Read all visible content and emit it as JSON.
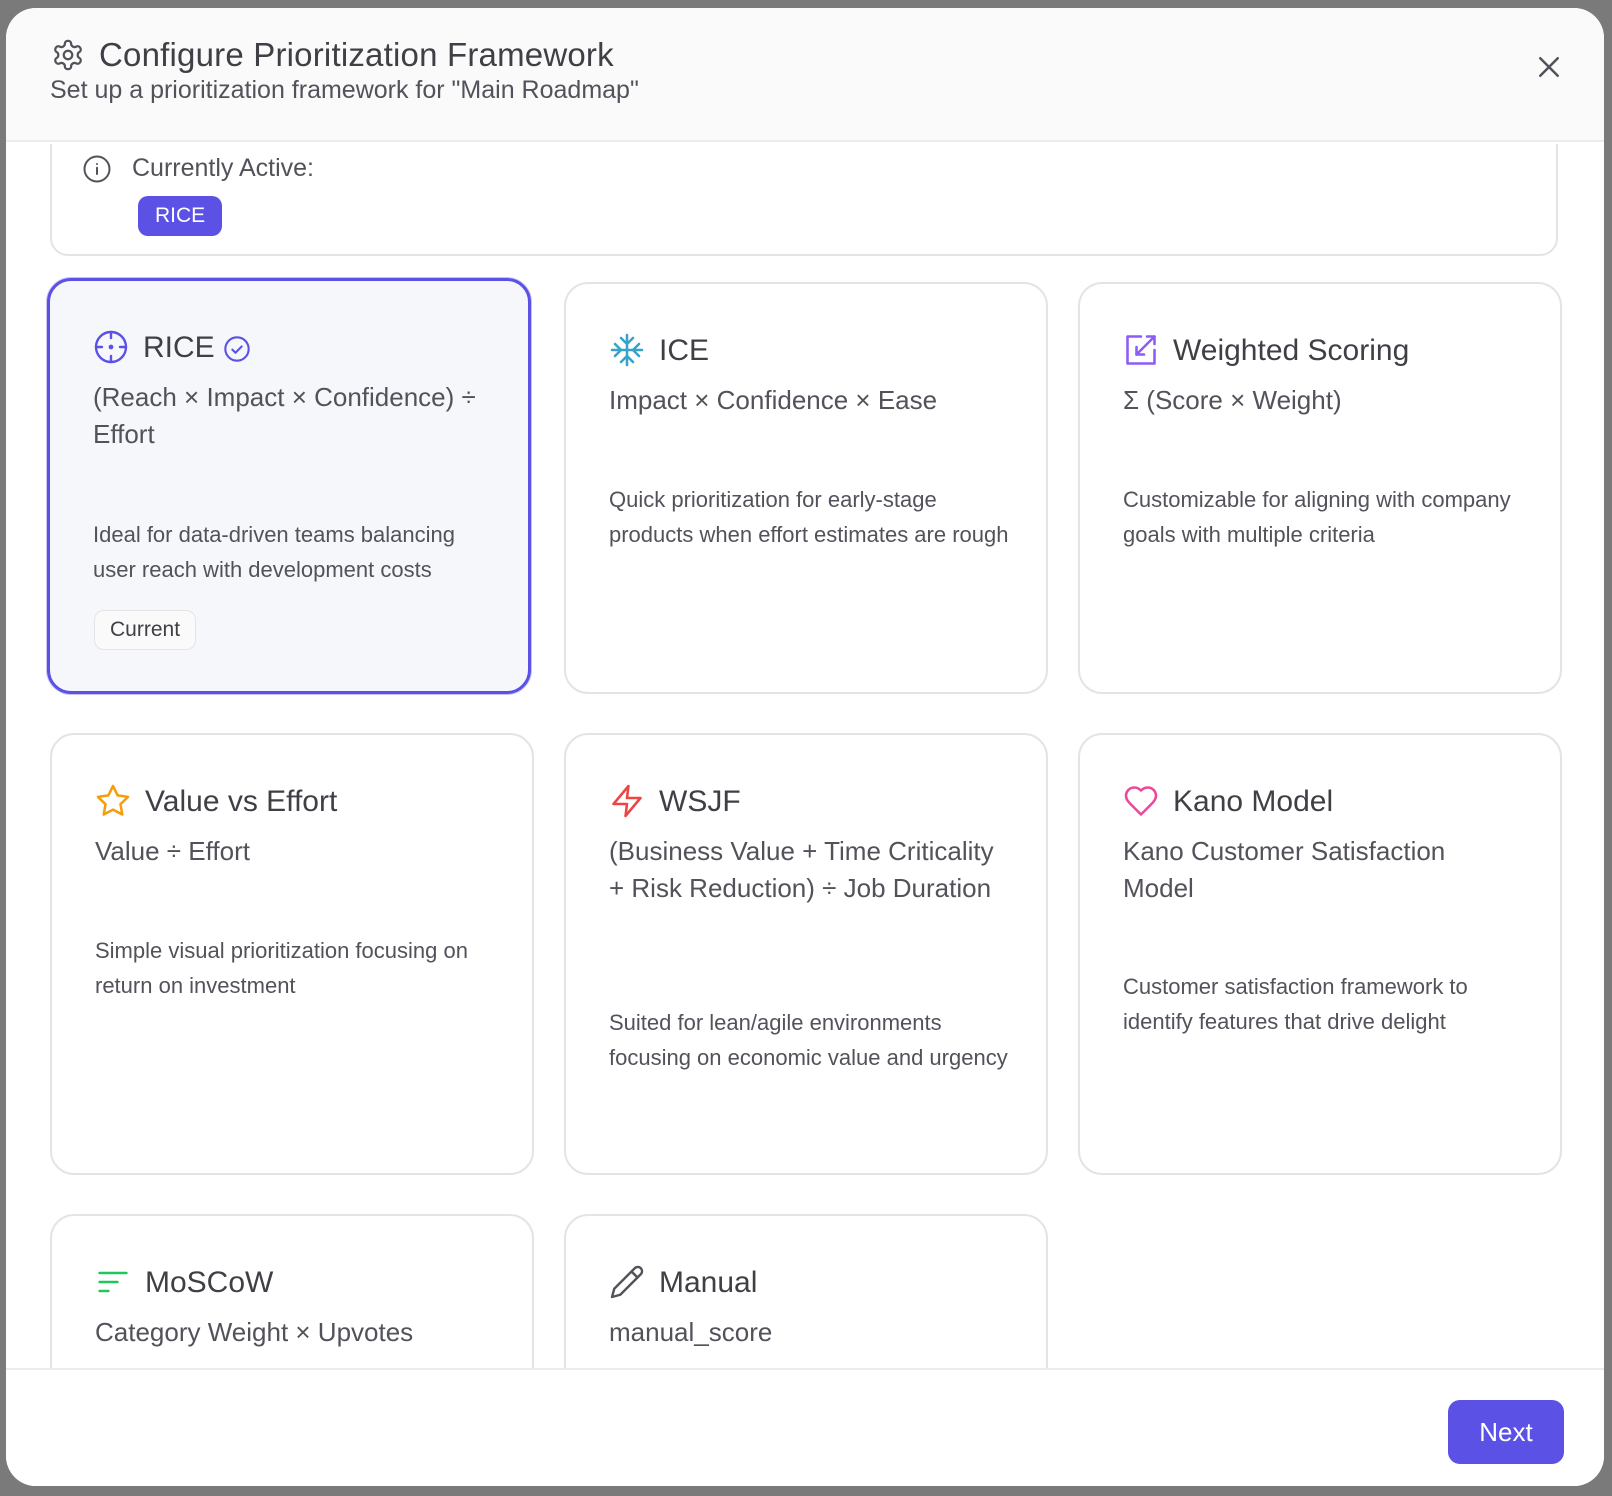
{
  "header": {
    "title": "Configure Prioritization Framework",
    "subtitle": "Set up a prioritization framework for \"Main Roadmap\"",
    "gear_icon": "gear-icon",
    "close_icon": "close-icon"
  },
  "active": {
    "label": "Currently Active:",
    "badge": "RICE",
    "info_icon": "info-icon"
  },
  "frameworks": [
    {
      "name": "RICE",
      "icon": "crosshair-icon",
      "icon_color": "#5b51e5",
      "formula": "(Reach × Impact × Confidence) ÷ Effort",
      "description": "Ideal for data-driven teams balancing user reach with development costs",
      "selected": true,
      "badge": "Current"
    },
    {
      "name": "ICE",
      "icon": "snowflake-icon",
      "icon_color": "#38a3c9",
      "formula": "Impact × Confidence × Ease",
      "description": "Quick prioritization for early-stage products when effort estimates are rough"
    },
    {
      "name": "Weighted Scoring",
      "icon": "scale-arrow-icon",
      "icon_color": "#8b5cf6",
      "formula": "Σ (Score × Weight)",
      "description": "Customizable for aligning with company goals with multiple criteria"
    },
    {
      "name": "Value vs Effort",
      "icon": "star-icon",
      "icon_color": "#f59e0b",
      "formula": "Value ÷ Effort",
      "description": "Simple visual prioritization focusing on return on investment"
    },
    {
      "name": "WSJF",
      "icon": "lightning-icon",
      "icon_color": "#ef4444",
      "formula": "(Business Value + Time Criticality + Risk Reduction) ÷ Job Duration",
      "description": "Suited for lean/agile environments focusing on economic value and urgency"
    },
    {
      "name": "Kano Model",
      "icon": "heart-icon",
      "icon_color": "#ec4899",
      "formula": "Kano Customer Satisfaction Model",
      "description": "Customer satisfaction framework to identify features that drive delight"
    },
    {
      "name": "MoSCoW",
      "icon": "list-filter-icon",
      "icon_color": "#22c55e",
      "formula": "Category Weight × Upvotes",
      "description": ""
    },
    {
      "name": "Manual",
      "icon": "pencil-icon",
      "icon_color": "#52525b",
      "formula": "manual_score",
      "description": ""
    }
  ],
  "footer": {
    "next_label": "Next"
  }
}
